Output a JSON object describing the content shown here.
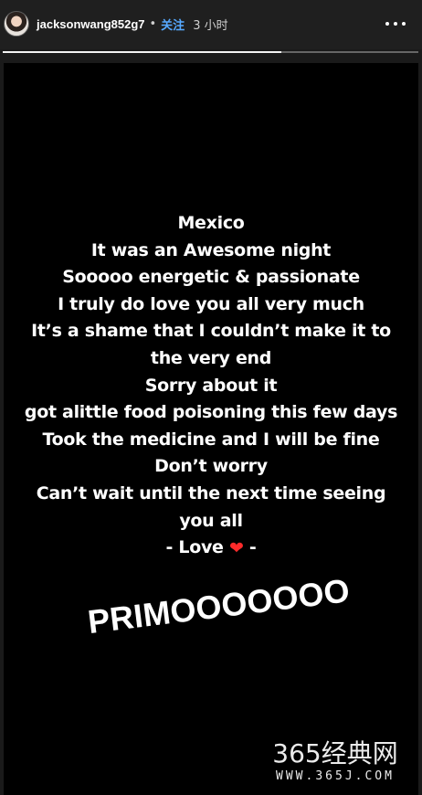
{
  "header": {
    "username": "jacksonwang852g7",
    "separator": "•",
    "follow_label": "关注",
    "time_label": "3 小时"
  },
  "story": {
    "progress": 0.67,
    "lines": [
      "Mexico",
      "It was an Awesome night",
      "Sooooo energetic & passionate",
      "I truly do love you all very much",
      "It’s a shame that I couldn’t make it to",
      "the very end",
      "Sorry about it",
      "got alittle food poisoning this few days",
      "Took the medicine and I will be fine",
      "Don’t worry",
      "Can’t wait until the next time seeing",
      "you all"
    ],
    "love_prefix": "- Love ",
    "heart_symbol": "❤",
    "love_suffix": " -",
    "sticker_text": "PRIMOOOOOOO"
  },
  "watermark": {
    "main": "365经典网",
    "sub": "WWW.365J.COM"
  },
  "icons": {
    "more": "more-icon",
    "heart": "heart-icon"
  },
  "colors": {
    "follow": "#56a9ff",
    "heart": "#ff2b2b"
  }
}
